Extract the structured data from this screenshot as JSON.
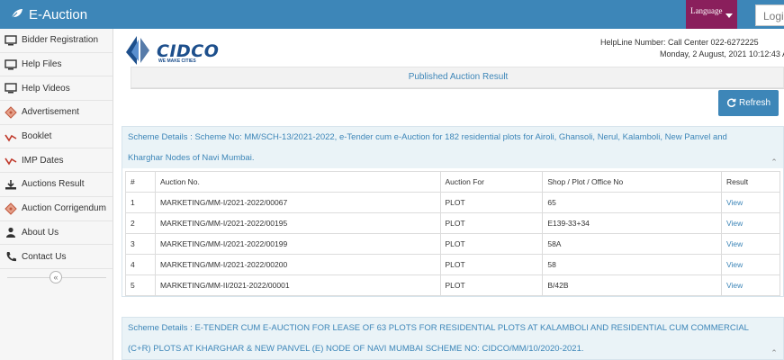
{
  "app": {
    "title": "E-Auction"
  },
  "header": {
    "language_label": "Language",
    "login_label": "Login"
  },
  "sidebar": {
    "items": [
      {
        "label": "Bidder Registration",
        "icon": "monitor-icon"
      },
      {
        "label": "Help Files",
        "icon": "monitor-icon"
      },
      {
        "label": "Help Videos",
        "icon": "monitor-icon"
      },
      {
        "label": "Advertisement",
        "icon": "tag-icon"
      },
      {
        "label": "Booklet",
        "icon": "chart-icon"
      },
      {
        "label": "IMP Dates",
        "icon": "chart-icon"
      },
      {
        "label": "Auctions Result",
        "icon": "download-icon"
      },
      {
        "label": "Auction Corrigendum",
        "icon": "tag-icon"
      },
      {
        "label": "About Us",
        "icon": "user-icon"
      },
      {
        "label": "Contact Us",
        "icon": "phone-icon"
      }
    ],
    "collapse_symbol": "«"
  },
  "logo": {
    "name": "CIDCO",
    "tagline": "WE MAKE CITIES"
  },
  "info": {
    "helpline": "HelpLine Number: Call Center 022-6272225",
    "datetime": "Monday, 2 August, 2021 10:12:43 A"
  },
  "page": {
    "title": "Published Auction Result",
    "refresh_label": "Refresh"
  },
  "schemes": [
    {
      "details": "Scheme Details : Scheme No: MM/SCH-13/2021-2022, e-Tender cum e-Auction for 182 residential plots for Airoli, Ghansoli, Nerul, Kalamboli, New Panvel and Kharghar Nodes of Navi Mumbai.",
      "columns": [
        "#",
        "Auction No.",
        "Auction For",
        "Shop / Plot / Office No",
        "Result"
      ],
      "rows": [
        {
          "num": "1",
          "auction_no": "MARKETING/MM-I/2021-2022/00067",
          "auction_for": "PLOT",
          "unit": "65",
          "result": "View"
        },
        {
          "num": "2",
          "auction_no": "MARKETING/MM-I/2021-2022/00195",
          "auction_for": "PLOT",
          "unit": "E139-33+34",
          "result": "View"
        },
        {
          "num": "3",
          "auction_no": "MARKETING/MM-I/2021-2022/00199",
          "auction_for": "PLOT",
          "unit": "58A",
          "result": "View"
        },
        {
          "num": "4",
          "auction_no": "MARKETING/MM-I/2021-2022/00200",
          "auction_for": "PLOT",
          "unit": "58",
          "result": "View"
        },
        {
          "num": "5",
          "auction_no": "MARKETING/MM-II/2021-2022/00001",
          "auction_for": "PLOT",
          "unit": "B/42B",
          "result": "View"
        }
      ]
    },
    {
      "details": "Scheme Details : E-TENDER CUM E-AUCTION FOR LEASE OF 63 PLOTS FOR RESIDENTIAL PLOTS AT KALAMBOLI AND RESIDENTIAL CUM COMMERCIAL (C+R) PLOTS AT KHARGHAR & NEW PANVEL (E) NODE OF NAVI MUMBAI SCHEME NO: CIDCO/MM/10/2020-2021."
    }
  ],
  "colors": {
    "header_bg": "#3d86b8",
    "language_bg": "#8a1f5c",
    "link": "#3d86b8",
    "panel_head_bg": "#eaf3f7"
  }
}
